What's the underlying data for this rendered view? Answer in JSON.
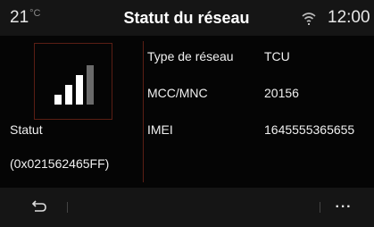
{
  "status_bar": {
    "temperature": "21",
    "temperature_unit": "°C",
    "time": "12:00"
  },
  "title": "Statut du réseau",
  "left_panel": {
    "status_label": "Statut",
    "status_code": "(0x021562465FF)",
    "signal_level": 0.75
  },
  "info_rows": [
    {
      "key": "Type de réseau",
      "value": "TCU"
    },
    {
      "key": "MCC/MNC",
      "value": "20156"
    },
    {
      "key": "IMEI",
      "value": "1645555365655"
    }
  ],
  "icons": {
    "back": "back-arrow-icon",
    "more": "more-options-icon",
    "wifi": "wifi-icon",
    "signal": "signal-strength-icon"
  },
  "colors": {
    "accent_border": "#5a1e14",
    "signal_active": "#ffffff",
    "signal_inactive": "#6a6a6a"
  },
  "bottom_bar": {
    "more_label": "···"
  }
}
